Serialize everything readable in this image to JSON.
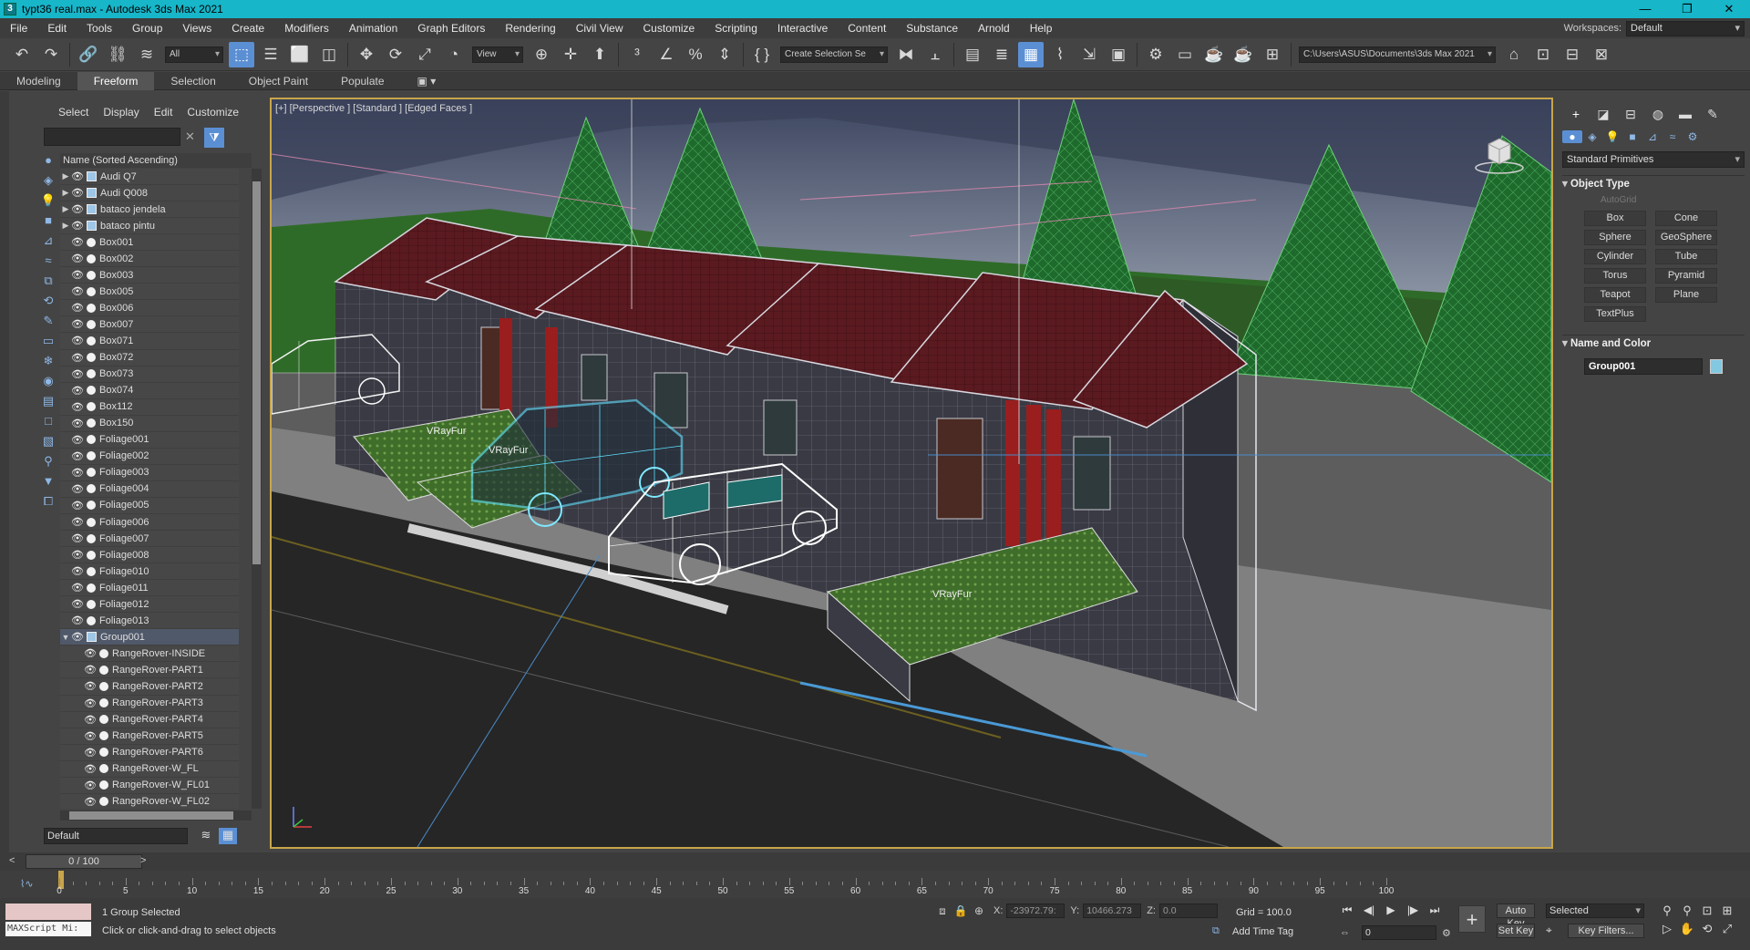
{
  "window": {
    "title": "typt36 real.max - Autodesk 3ds Max 2021",
    "app_icon": "3",
    "controls": [
      "—",
      "❐",
      "✕"
    ]
  },
  "menu": {
    "items": [
      "File",
      "Edit",
      "Tools",
      "Group",
      "Views",
      "Create",
      "Modifiers",
      "Animation",
      "Graph Editors",
      "Rendering",
      "Civil View",
      "Customize",
      "Scripting",
      "Interactive",
      "Content",
      "Substance",
      "Arnold",
      "Help"
    ],
    "workspaces_label": "Workspaces:",
    "workspace_value": "Default"
  },
  "toolbar": {
    "selection_filter": "All",
    "ref_coord": "View",
    "named_selection": "Create Selection Se",
    "project_path": "C:\\Users\\ASUS\\Documents\\3ds Max 2021"
  },
  "ribbon": {
    "tabs": [
      "Modeling",
      "Freeform",
      "Selection",
      "Object Paint",
      "Populate"
    ],
    "active": "Freeform"
  },
  "scene_explorer": {
    "tabs": [
      "Select",
      "Display",
      "Edit",
      "Customize"
    ],
    "column_header": "Name (Sorted Ascending)",
    "layer": "Default",
    "rows": [
      {
        "name": "Audi Q7",
        "expand": "▶",
        "group": true
      },
      {
        "name": "Audi Q008",
        "expand": "▶",
        "group": true
      },
      {
        "name": "bataco jendela",
        "expand": "▶",
        "group": true
      },
      {
        "name": "bataco pintu",
        "expand": "▶",
        "group": true
      },
      {
        "name": "Box001"
      },
      {
        "name": "Box002"
      },
      {
        "name": "Box003"
      },
      {
        "name": "Box005"
      },
      {
        "name": "Box006"
      },
      {
        "name": "Box007"
      },
      {
        "name": "Box071"
      },
      {
        "name": "Box072"
      },
      {
        "name": "Box073"
      },
      {
        "name": "Box074"
      },
      {
        "name": "Box112"
      },
      {
        "name": "Box150"
      },
      {
        "name": "Foliage001"
      },
      {
        "name": "Foliage002"
      },
      {
        "name": "Foliage003"
      },
      {
        "name": "Foliage004"
      },
      {
        "name": "Foliage005"
      },
      {
        "name": "Foliage006"
      },
      {
        "name": "Foliage007"
      },
      {
        "name": "Foliage008"
      },
      {
        "name": "Foliage010"
      },
      {
        "name": "Foliage011"
      },
      {
        "name": "Foliage012"
      },
      {
        "name": "Foliage013"
      },
      {
        "name": "Group001",
        "expand": "▼",
        "group": true,
        "selected": true
      },
      {
        "name": "RangeRover-INSIDE",
        "child": true
      },
      {
        "name": "RangeRover-PART1",
        "child": true
      },
      {
        "name": "RangeRover-PART2",
        "child": true
      },
      {
        "name": "RangeRover-PART3",
        "child": true
      },
      {
        "name": "RangeRover-PART4",
        "child": true
      },
      {
        "name": "RangeRover-PART5",
        "child": true
      },
      {
        "name": "RangeRover-PART6",
        "child": true
      },
      {
        "name": "RangeRover-W_FL",
        "child": true
      },
      {
        "name": "RangeRover-W_FL01",
        "child": true
      },
      {
        "name": "RangeRover-W_FL02",
        "child": true
      }
    ]
  },
  "viewport": {
    "label": "[+] [Perspective ] [Standard ] [Edged Faces ]",
    "fur_labels": [
      "VRayFur",
      "VRayFur",
      "VRayFur"
    ],
    "viewcube_icon": "viewcube"
  },
  "command_panel": {
    "category": "Standard Primitives",
    "object_type_title": "Object Type",
    "autogrid": "AutoGrid",
    "primitives": [
      "Box",
      "Cone",
      "Sphere",
      "GeoSphere",
      "Cylinder",
      "Tube",
      "Torus",
      "Pyramid",
      "Teapot",
      "Plane",
      "TextPlus"
    ],
    "name_color_title": "Name and Color",
    "object_name": "Group001",
    "object_color": "#82c8e0"
  },
  "time": {
    "frame_display": "0 / 100",
    "ticks": [
      0,
      5,
      10,
      15,
      20,
      25,
      30,
      35,
      40,
      45,
      50,
      55,
      60,
      65,
      70,
      75,
      80,
      85,
      90,
      95,
      100
    ]
  },
  "status": {
    "maxscript": "MAXScript Mi:",
    "line1": "1 Group Selected",
    "line2": "Click or click-and-drag to select objects",
    "x_label": "X:",
    "x_value": "-23972.79:",
    "y_label": "Y:",
    "y_value": "10466.273",
    "z_label": "Z:",
    "z_value": "0.0",
    "grid": "Grid = 100.0",
    "add_time_tag": "Add Time Tag",
    "frame_value": "0",
    "auto_key": "Auto Key",
    "set_key": "Set Key",
    "selected": "Selected",
    "key_filters": "Key Filters..."
  }
}
